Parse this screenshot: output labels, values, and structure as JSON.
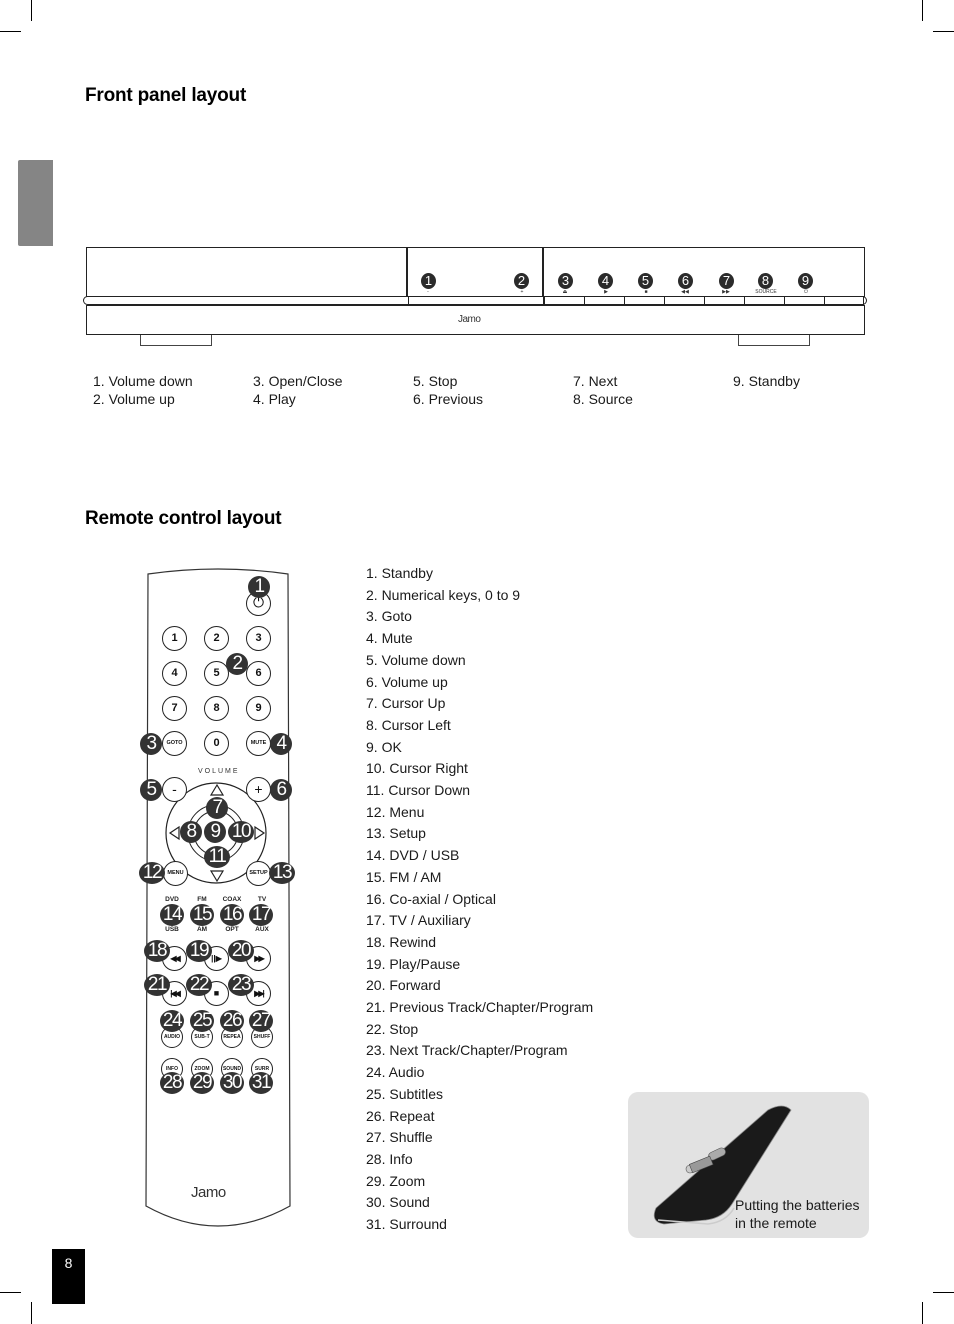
{
  "page": {
    "number": "8",
    "side_tab_color": "#858585"
  },
  "front_panel": {
    "title": "Front panel layout",
    "brand": "Jamo",
    "callouts": [
      "1",
      "2",
      "3",
      "4",
      "5",
      "6",
      "7",
      "8",
      "9"
    ],
    "button_symbols": [
      "-",
      "+",
      "⏏",
      "▶",
      "■",
      "◀◀",
      "▶▶",
      "SOURCE",
      "⏻"
    ],
    "legend": [
      "1. Volume down",
      "2. Volume up",
      "3. Open/Close",
      "4. Play",
      "5. Stop",
      "6. Previous",
      "7. Next",
      "8. Source",
      "9. Standby"
    ]
  },
  "remote": {
    "title": "Remote control layout",
    "brand": "Jamo",
    "volume_label": "VOLUME",
    "keys": {
      "num": [
        "1",
        "2",
        "3",
        "4",
        "5",
        "6",
        "7",
        "8",
        "9",
        "0"
      ],
      "goto": "GOTO",
      "mute": "MUTE",
      "vol_down": "-",
      "vol_up": "+",
      "menu": "MENU",
      "setup": "SETUP",
      "source_top": [
        "DVD",
        "FM",
        "COAX",
        "TV"
      ],
      "source_bottom": [
        "USB",
        "AM",
        "OPT",
        "AUX"
      ],
      "transport_row1": [
        "◀◀",
        "||▶",
        "▶▶"
      ],
      "transport_row2": [
        "|◀◀",
        "■",
        "▶▶|"
      ],
      "func_row1": [
        "AUDIO",
        "SUB-T",
        "REPEA",
        "SHUFF"
      ],
      "func_row2": [
        "INFO",
        "ZOOM",
        "SOUND",
        "SURR"
      ]
    },
    "callouts": [
      "1",
      "2",
      "3",
      "4",
      "5",
      "6",
      "7",
      "8",
      "9",
      "10",
      "11",
      "12",
      "13",
      "14",
      "15",
      "16",
      "17",
      "18",
      "19",
      "20",
      "21",
      "22",
      "23",
      "24",
      "25",
      "26",
      "27",
      "28",
      "29",
      "30",
      "31"
    ],
    "legend": [
      "1. Standby",
      "2. Numerical keys, 0 to 9",
      "3. Goto",
      "4. Mute",
      "5. Volume down",
      "6. Volume up",
      "7. Cursor Up",
      "8. Cursor Left",
      "9. OK",
      "10. Cursor Right",
      "11. Cursor Down",
      "12. Menu",
      "13. Setup",
      "14. DVD / USB",
      "15. FM / AM",
      "16. Co-axial / Optical",
      "17. TV / Auxiliary",
      "18. Rewind",
      "19. Play/Pause",
      "20. Forward",
      "21. Previous Track/Chapter/Program",
      "22. Stop",
      "23. Next Track/Chapter/Program",
      "24. Audio",
      "25. Subtitles",
      "26. Repeat",
      "27. Shuffle",
      "28. Info",
      "29. Zoom",
      "30. Sound",
      "31. Surround"
    ]
  },
  "battery": {
    "caption_line1": "Putting the batteries",
    "caption_line2": "in the remote",
    "box_color": "#e2e2e2"
  }
}
